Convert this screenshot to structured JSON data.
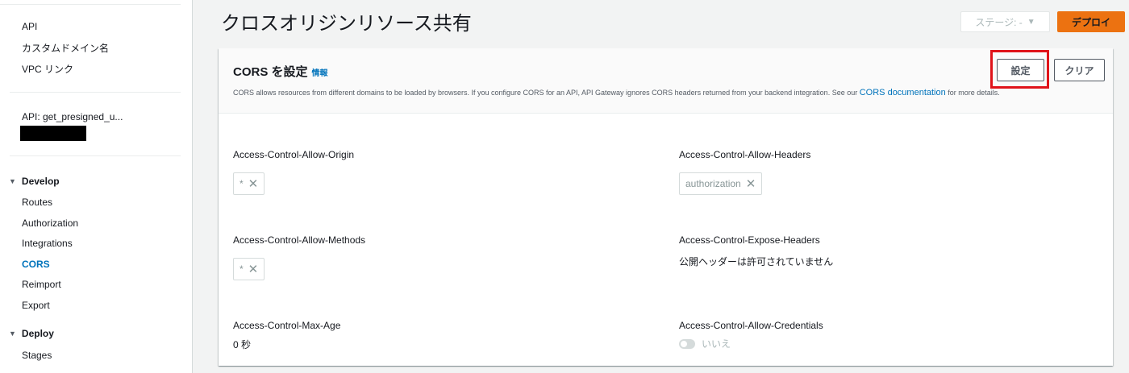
{
  "sidebar": {
    "top_items": [
      "API",
      "カスタムドメイン名",
      "VPC リンク"
    ],
    "api_name": "API: get_presigned_u...",
    "develop": {
      "title": "Develop",
      "items": [
        "Routes",
        "Authorization",
        "Integrations",
        "CORS",
        "Reimport",
        "Export"
      ],
      "active": "CORS"
    },
    "deploy": {
      "title": "Deploy",
      "items": [
        "Stages"
      ]
    }
  },
  "header": {
    "title": "クロスオリジンリソース共有",
    "stage_label": "ステージ: -",
    "deploy_label": "デプロイ"
  },
  "panel": {
    "title": "CORS を設定",
    "info": "情報",
    "description_pre": "CORS allows resources from different domains to be loaded by browsers. If you configure CORS for an API, API Gateway ignores CORS headers returned from your backend integration. See our",
    "description_link": "CORS documentation",
    "description_post": "for more details.",
    "configure_label": "設定",
    "clear_label": "クリア"
  },
  "fields": {
    "allow_origin": {
      "label": "Access-Control-Allow-Origin",
      "token": "*"
    },
    "allow_headers": {
      "label": "Access-Control-Allow-Headers",
      "token": "authorization"
    },
    "allow_methods": {
      "label": "Access-Control-Allow-Methods",
      "token": "*"
    },
    "expose_headers": {
      "label": "Access-Control-Expose-Headers",
      "value": "公開ヘッダーは許可されていません"
    },
    "max_age": {
      "label": "Access-Control-Max-Age",
      "value": "0 秒"
    },
    "allow_credentials": {
      "label": "Access-Control-Allow-Credentials",
      "toggle_label": "いいえ"
    }
  },
  "colors": {
    "accent": "#0073bb",
    "deploy": "#ec7211",
    "highlight": "#e0131a"
  },
  "icons": {
    "remove": "close-icon",
    "dropdown": "caret-down-icon",
    "section": "caret-down-icon"
  }
}
